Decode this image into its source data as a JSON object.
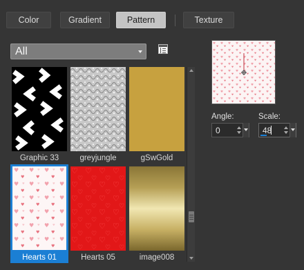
{
  "tabs": [
    {
      "label": "Color",
      "active": false
    },
    {
      "label": "Gradient",
      "active": false
    },
    {
      "label": "Pattern",
      "active": true
    },
    {
      "label": "Texture",
      "active": false
    }
  ],
  "category_dropdown": {
    "selected": "All"
  },
  "library_icon": "open-library-icon",
  "patterns": [
    {
      "name": "Graphic 33",
      "selected": false
    },
    {
      "name": "greyjungle",
      "selected": false
    },
    {
      "name": "gSwGold",
      "selected": false
    },
    {
      "name": "Hearts 01",
      "selected": true
    },
    {
      "name": "Hearts 05",
      "selected": false
    },
    {
      "name": "image008",
      "selected": false
    }
  ],
  "angle": {
    "label": "Angle:",
    "value": "0"
  },
  "scale": {
    "label": "Scale:",
    "value": "48"
  },
  "colors": {
    "accent": "#1b7fd4",
    "background": "#353535",
    "active_tab": "#c4c4c4"
  }
}
